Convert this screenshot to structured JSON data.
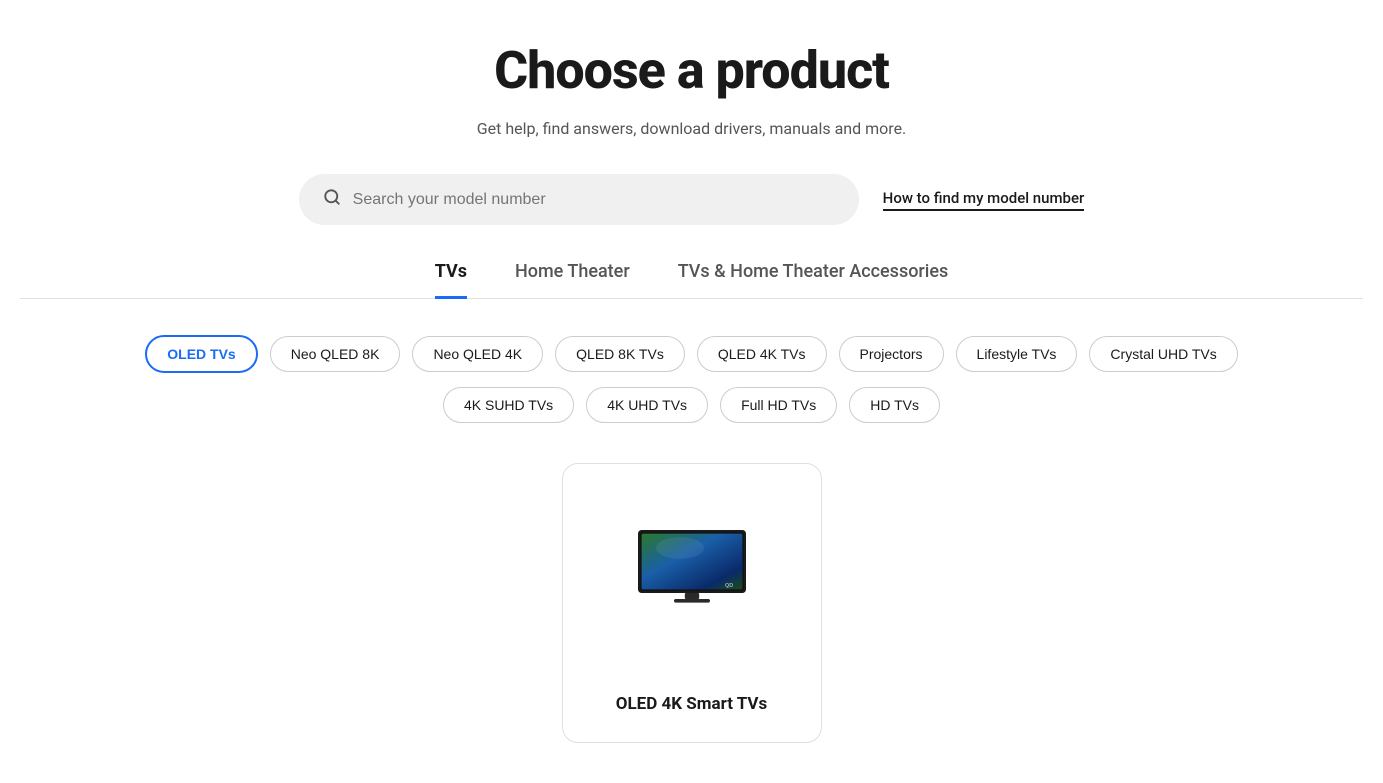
{
  "page": {
    "title": "Choose a product",
    "subtitle": "Get help, find answers, download drivers, manuals and more."
  },
  "search": {
    "placeholder": "Search your model number",
    "find_model_label": "How to find my model number"
  },
  "tabs": [
    {
      "id": "tvs",
      "label": "TVs",
      "active": true
    },
    {
      "id": "home-theater",
      "label": "Home Theater",
      "active": false
    },
    {
      "id": "accessories",
      "label": "TVs & Home Theater Accessories",
      "active": false
    }
  ],
  "filters_row1": [
    {
      "id": "oled-tvs",
      "label": "OLED TVs",
      "active": true
    },
    {
      "id": "neo-qled-8k",
      "label": "Neo QLED 8K",
      "active": false
    },
    {
      "id": "neo-qled-4k",
      "label": "Neo QLED 4K",
      "active": false
    },
    {
      "id": "qled-8k",
      "label": "QLED 8K TVs",
      "active": false
    },
    {
      "id": "qled-4k",
      "label": "QLED 4K TVs",
      "active": false
    },
    {
      "id": "projectors",
      "label": "Projectors",
      "active": false
    },
    {
      "id": "lifestyle",
      "label": "Lifestyle TVs",
      "active": false
    },
    {
      "id": "crystal-uhd",
      "label": "Crystal UHD TVs",
      "active": false
    }
  ],
  "filters_row2": [
    {
      "id": "4k-suhd",
      "label": "4K SUHD TVs",
      "active": false
    },
    {
      "id": "4k-uhd",
      "label": "4K UHD TVs",
      "active": false
    },
    {
      "id": "full-hd",
      "label": "Full HD TVs",
      "active": false
    },
    {
      "id": "hd-tvs",
      "label": "HD TVs",
      "active": false
    }
  ],
  "products": [
    {
      "id": "oled-4k-smart",
      "name": "OLED 4K Smart TVs",
      "image_type": "tv"
    }
  ],
  "colors": {
    "active_tab_border": "#1a6cf6",
    "active_pill_color": "#1a6cf6"
  }
}
